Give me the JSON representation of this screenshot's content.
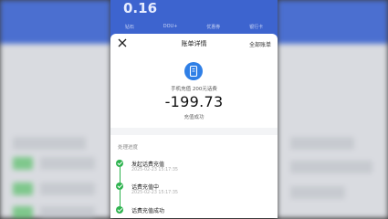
{
  "header": {
    "balance": "0.16",
    "tabs": [
      "钻石",
      "DOU+",
      "优惠券",
      "银行卡"
    ]
  },
  "sheet": {
    "title": "账单详情",
    "all_bills": "全部账单",
    "description": "手机充值 200元话费",
    "amount": "-199.73",
    "status": "充值成功"
  },
  "process": {
    "title": "处理进度",
    "steps": [
      {
        "label": "发起话费充值",
        "time": "2025-02-23 15:17:35"
      },
      {
        "label": "话费充值中",
        "time": "2025-02-23 15:17:35"
      },
      {
        "label": "话费充值成功",
        "time": ""
      }
    ]
  },
  "colors": {
    "accent_blue": "#3d64cf",
    "icon_blue": "#2f7fe6",
    "success_green": "#2eb34f"
  }
}
